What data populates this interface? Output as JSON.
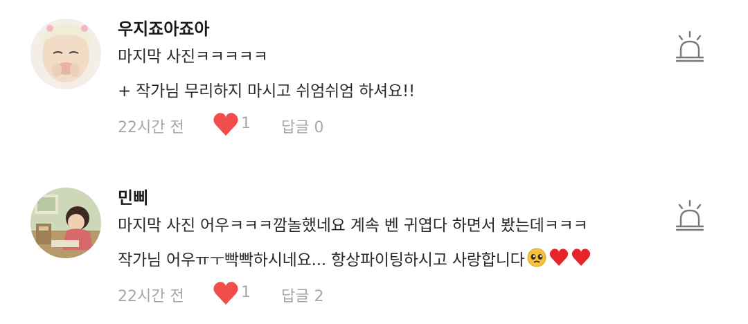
{
  "comments": [
    {
      "username": "우지죠아죠아",
      "lines": [
        "마지막 사진ㅋㅋㅋㅋㅋ",
        "+ 작가님 무리하지 마시고 쉬엄쉬엄 하셔요!!"
      ],
      "time": "22시간 전",
      "likes": "1",
      "reply": "답글 0",
      "avatar_icon": "user-avatar-photo",
      "report_icon": "siren-icon"
    },
    {
      "username": "민삐",
      "lines": [
        "마지막 사진 어우ㅋㅋㅋ깜놀했네요 계속 벤 귀엽다 하면서 봤는데ㅋㅋㅋ",
        "작가님 어우ㅠㅜ빡빡하시네요... 항상파이팅하시고 사랑합니다"
      ],
      "time": "22시간 전",
      "likes": "1",
      "reply": "답글 2",
      "avatar_icon": "user-avatar-illustration",
      "report_icon": "siren-icon"
    }
  ],
  "colors": {
    "heart": "#f24d4d",
    "meta_text": "#a6a6a6",
    "report_icon": "#777777"
  }
}
